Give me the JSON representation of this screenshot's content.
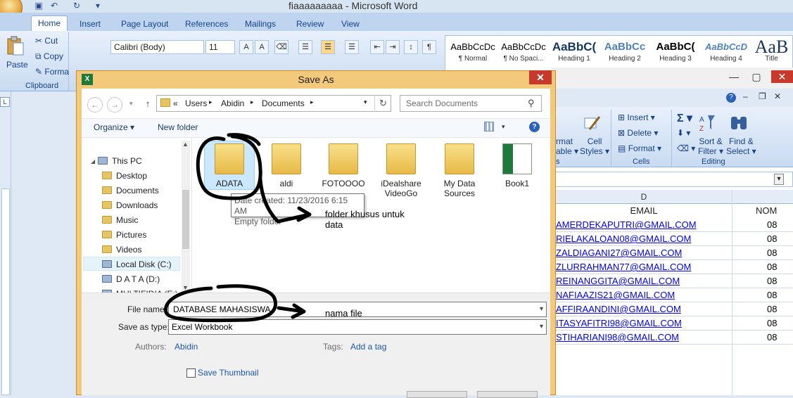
{
  "word": {
    "title": "fiaaaaaaaaa - Microsoft Word",
    "tabs": [
      "Home",
      "Insert",
      "Page Layout",
      "References",
      "Mailings",
      "Review",
      "View"
    ],
    "clipboard": {
      "paste": "Paste",
      "cut": "Cut",
      "copy": "Copy",
      "format": "Forma",
      "group_label": "Clipboard"
    },
    "font_name": "Calibri (Body)",
    "font_size": "11",
    "styles": [
      {
        "sample": "AaBbCcDc",
        "name": "¶ Normal"
      },
      {
        "sample": "AaBbCcDc",
        "name": "¶ No Spaci..."
      },
      {
        "sample": "AaBbC(",
        "name": "Heading 1"
      },
      {
        "sample": "AaBbCc",
        "name": "Heading 2"
      },
      {
        "sample": "AaBbC(",
        "name": "Heading 3"
      },
      {
        "sample": "AaBbCcD",
        "name": "Heading 4"
      },
      {
        "sample": "AaB",
        "name": "Title"
      }
    ]
  },
  "excel": {
    "buttons": {
      "format": "rmat",
      "table": "able ▾",
      "cell": "Cell",
      "styles": "Styles ▾",
      "insert": "Insert ▾",
      "delete": "Delete ▾",
      "format2": "Format ▾",
      "sort": "Sort &",
      "filter": "Filter ▾",
      "find": "Find &",
      "select": "Select ▾"
    },
    "groups": {
      "styles_frag": "s",
      "cells": "Cells",
      "editing": "Editing"
    },
    "column": "D",
    "header_email": "EMAIL",
    "header_no": "NOM",
    "emails": [
      "AMERDEKAPUTRI@GMAIL.COM",
      "RIELAKALOAN08@GMAIL.COM",
      "ZALDIAGANI27@GMAIL.COM",
      "ZLURRAHMAN77@GMAIL.COM",
      "REINANGGITA@GMAIL.COM",
      "NAFIAAZIS21@GMAIL.COM",
      "AFFIRAANDINI@GMAIL.COM",
      "ITASYAFITRI98@GMAIL.COM",
      "STIHARIANI98@GMAIL.COM"
    ],
    "num_prefix": "08"
  },
  "dialog": {
    "title": "Save As",
    "breadcrumb": [
      "«",
      "Users",
      "Abidin",
      "Documents"
    ],
    "search_placeholder": "Search Documents",
    "organize": "Organize ▾",
    "new_folder": "New folder",
    "tree": [
      "This PC",
      "Desktop",
      "Documents",
      "Downloads",
      "Music",
      "Pictures",
      "Videos",
      "Local Disk (C:)",
      "D A T A (D:)",
      "MULTIFIDIA (E:)"
    ],
    "files": [
      {
        "name": "ADATA",
        "type": "folder"
      },
      {
        "name": "aldi",
        "type": "folder"
      },
      {
        "name": "FOTOOOO",
        "type": "folder"
      },
      {
        "name": "iDealshare VideoGo",
        "type": "folder"
      },
      {
        "name": "My Data Sources",
        "type": "folder"
      },
      {
        "name": "Book1",
        "type": "excel"
      }
    ],
    "tooltip_line1": "Date created: 11/23/2016 6:15 AM",
    "tooltip_line2": "Empty folder",
    "file_name_label": "File name:",
    "file_name_value": "DATABASE MAHASISWA",
    "save_type_label": "Save as type:",
    "save_type_value": "Excel Workbook",
    "authors_label": "Authors:",
    "authors_value": "Abidin",
    "tags_label": "Tags:",
    "tags_value": "Add a tag",
    "save_thumbnail": "Save Thumbnail"
  },
  "annotations": {
    "folder_note": "folder khusus untuk data",
    "file_note": "nama file"
  },
  "colors": {
    "dialog_border": "#f3c97c",
    "close_button": "#c7392b",
    "link": "#1e5aa8"
  }
}
